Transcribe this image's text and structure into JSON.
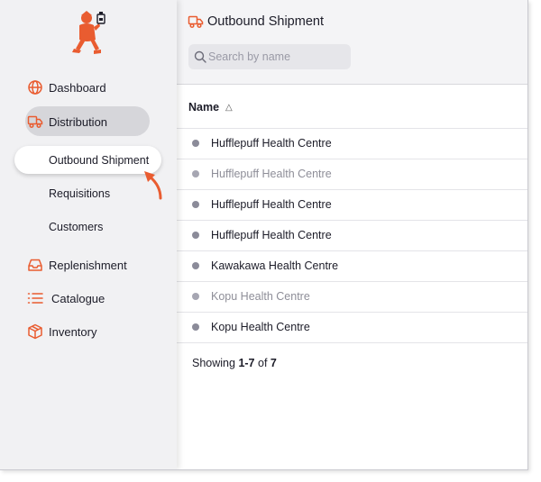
{
  "app": {
    "brand_color": "#e95c30"
  },
  "sidebar": {
    "items": [
      {
        "label": "Dashboard",
        "icon": "globe-icon"
      },
      {
        "label": "Distribution",
        "icon": "truck-icon"
      },
      {
        "label": "Replenishment",
        "icon": "inbox-icon"
      },
      {
        "label": "Catalogue",
        "icon": "list-icon"
      },
      {
        "label": "Inventory",
        "icon": "box-icon"
      }
    ],
    "sub_items": [
      {
        "label": "Outbound Shipment"
      },
      {
        "label": "Requisitions"
      },
      {
        "label": "Customers"
      }
    ]
  },
  "header": {
    "title": "Outbound Shipment",
    "icon": "truck-icon"
  },
  "search": {
    "placeholder": "Search by name",
    "value": ""
  },
  "table": {
    "columns": [
      {
        "label": "Name",
        "sort": "ascending"
      }
    ],
    "rows": [
      {
        "name": "Hufflepuff Health Centre",
        "muted": false
      },
      {
        "name": "Hufflepuff Health Centre",
        "muted": true
      },
      {
        "name": "Hufflepuff Health Centre",
        "muted": false
      },
      {
        "name": "Hufflepuff Health Centre",
        "muted": false
      },
      {
        "name": "Kawakawa Health Centre",
        "muted": false
      },
      {
        "name": "Kopu Health Centre",
        "muted": true
      },
      {
        "name": "Kopu Health Centre",
        "muted": false
      }
    ]
  },
  "footer": {
    "prefix": "Showing ",
    "range": "1-7",
    "of": " of ",
    "total": "7"
  }
}
